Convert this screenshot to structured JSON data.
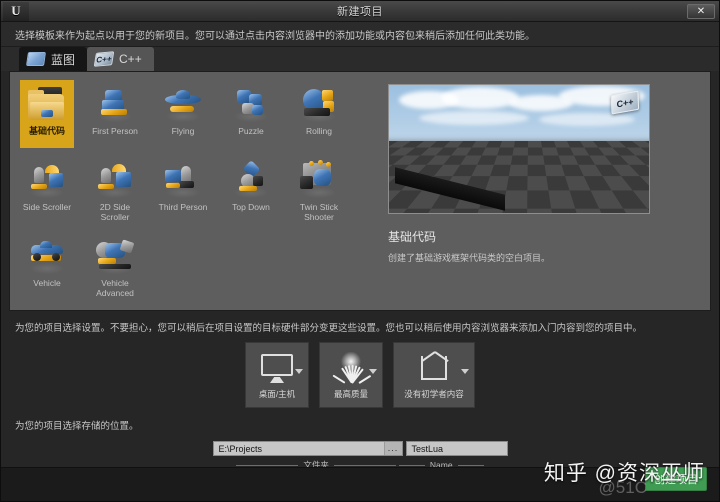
{
  "window": {
    "title": "新建项目",
    "logo_glyph": "U",
    "close_label": "✕"
  },
  "intro": {
    "text": "选择模板来作为起点以用于您的新项目。您可以通过点击内容浏览器中的添加功能或内容包来稍后添加任何此类功能。"
  },
  "tabs": [
    {
      "label": "蓝图",
      "icon": "blueprint-icon",
      "icon_text": "",
      "active": false
    },
    {
      "label": "C++",
      "icon": "cpp-icon",
      "icon_text": "C++",
      "active": true
    }
  ],
  "templates": [
    {
      "label": "基础代码",
      "selected": true,
      "art": "folder"
    },
    {
      "label": "First Person",
      "selected": false,
      "art": "fps"
    },
    {
      "label": "Flying",
      "selected": false,
      "art": "flying"
    },
    {
      "label": "Puzzle",
      "selected": false,
      "art": "puzzle"
    },
    {
      "label": "Rolling",
      "selected": false,
      "art": "rolling"
    },
    {
      "label": "Side Scroller",
      "selected": false,
      "art": "side"
    },
    {
      "label": "2D Side Scroller",
      "selected": false,
      "art": "side2d"
    },
    {
      "label": "Third Person",
      "selected": false,
      "art": "third"
    },
    {
      "label": "Top Down",
      "selected": false,
      "art": "topdown"
    },
    {
      "label": "Twin Stick Shooter",
      "selected": false,
      "art": "twinstick"
    },
    {
      "label": "Vehicle",
      "selected": false,
      "art": "vehicle"
    },
    {
      "label": "Vehicle Advanced",
      "selected": false,
      "art": "vehicleadv"
    }
  ],
  "preview": {
    "badge": "C++",
    "title": "基础代码",
    "description": "创建了基础游戏框架代码类的空白项目。"
  },
  "settings": {
    "note": "为您的项目选择设置。不要担心，您可以稍后在项目设置的目标硬件部分变更这些设置。您也可以稍后使用内容浏览器来添加入门内容到您的项目中。",
    "options": [
      {
        "label": "桌面/主机",
        "icon": "monitor-icon"
      },
      {
        "label": "最高质量",
        "icon": "quality-grass-icon"
      },
      {
        "label": "没有初学者内容",
        "icon": "starter-content-icon"
      }
    ]
  },
  "location": {
    "note": "为您的项目选择存储的位置。",
    "folder_value": "E:\\Projects",
    "folder_placeholder": "E:\\Projects",
    "browse_label": "...",
    "name_value": "TestLua",
    "name_placeholder": "Name",
    "folder_caption": "文件夹",
    "name_caption": "Name"
  },
  "footer": {
    "create_label": "创建项目",
    "watermark": "知乎 @资深巫师",
    "watermark_secondary": "@51C"
  },
  "colors": {
    "accent_selected": "#d8a41a",
    "create_green": "#3f9c52",
    "panel_bg": "#5e5e5e",
    "window_bg": "#262626"
  }
}
